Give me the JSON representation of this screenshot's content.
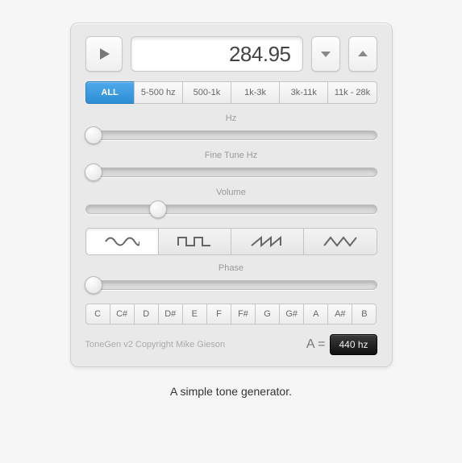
{
  "frequency_display": "284.95",
  "range_tabs": [
    "ALL",
    "5-500 hz",
    "500-1k",
    "1k-3k",
    "3k-11k",
    "11k - 28k"
  ],
  "range_active_index": 0,
  "sliders": {
    "hz": {
      "label": "Hz",
      "position": 3
    },
    "finetune": {
      "label": "Fine Tune Hz",
      "position": 3
    },
    "volume": {
      "label": "Volume",
      "position": 25
    },
    "phase": {
      "label": "Phase",
      "position": 3
    }
  },
  "wave_active_index": 0,
  "notes": [
    "C",
    "C#",
    "D",
    "D#",
    "E",
    "F",
    "F#",
    "G",
    "G#",
    "A",
    "A#",
    "B"
  ],
  "copyright": "ToneGen v2 Copyright Mike Gieson",
  "a_equals_label": "A =",
  "a_equals_value": "440 hz",
  "caption": "A simple tone generator."
}
